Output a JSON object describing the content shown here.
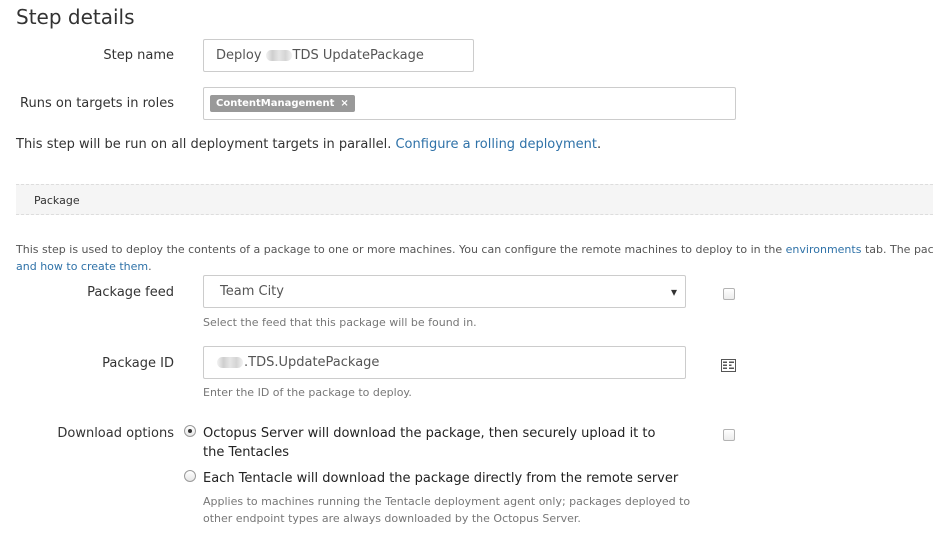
{
  "page": {
    "title": "Step details"
  },
  "step_name": {
    "label": "Step name",
    "value_prefix": "Deploy",
    "value_suffix": "TDS UpdatePackage"
  },
  "roles": {
    "label": "Runs on targets in roles",
    "chips": [
      "ContentManagement"
    ],
    "remove_glyph": "×"
  },
  "parallel": {
    "text": "This step will be run on all deployment targets in parallel.",
    "link": "Configure a rolling deployment",
    "trailing": "."
  },
  "package_section": {
    "header": "Package",
    "description_text": "This step is used to deploy the contents of a package to one or more machines. You can configure the remote machines to deploy to in the",
    "description_link": "environments",
    "description_after": "tab. The package th",
    "description_line2_link": "and how to create them",
    "description_line2_after": "."
  },
  "package_feed": {
    "label": "Package feed",
    "value": "Team City",
    "arrow": "▾",
    "help": "Select the feed that this package will be found in."
  },
  "package_id": {
    "label": "Package ID",
    "value_suffix": ".TDS.UpdatePackage",
    "help": "Enter the ID of the package to deploy.",
    "icon": "package-browser-icon"
  },
  "download_options": {
    "label": "Download options",
    "options": [
      {
        "text": "Octopus Server will download the package, then securely upload it to the Tentacles",
        "selected": true
      },
      {
        "text": "Each Tentacle will download the package directly from the remote server",
        "selected": false
      }
    ],
    "help": "Applies to machines running the Tentacle deployment agent only; packages deployed to other endpoint types are always downloaded by the Octopus Server."
  },
  "colors": {
    "link": "#2f72a8",
    "chip": "#999999",
    "band": "#f5f5f5"
  }
}
